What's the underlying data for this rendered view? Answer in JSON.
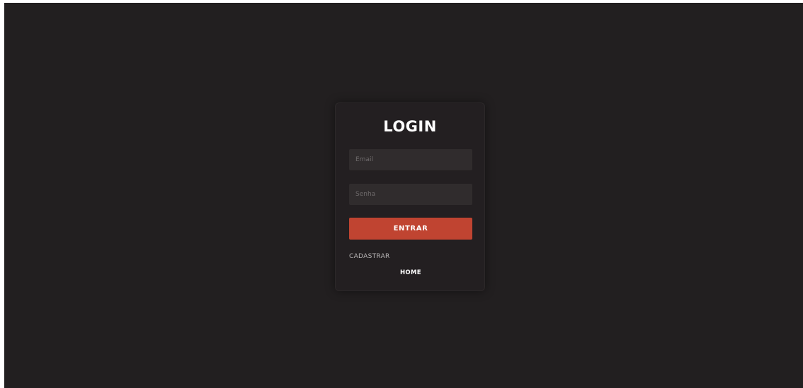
{
  "login": {
    "title": "LOGIN",
    "email_placeholder": "Email",
    "password_placeholder": "Senha",
    "submit_label": "ENTRAR",
    "register_link": "CADASTRAR",
    "home_link": "HOME"
  },
  "colors": {
    "background": "#221f20",
    "card": "#231f21",
    "input": "#302c2d",
    "accent": "#c04431",
    "text": "#ffffff"
  }
}
